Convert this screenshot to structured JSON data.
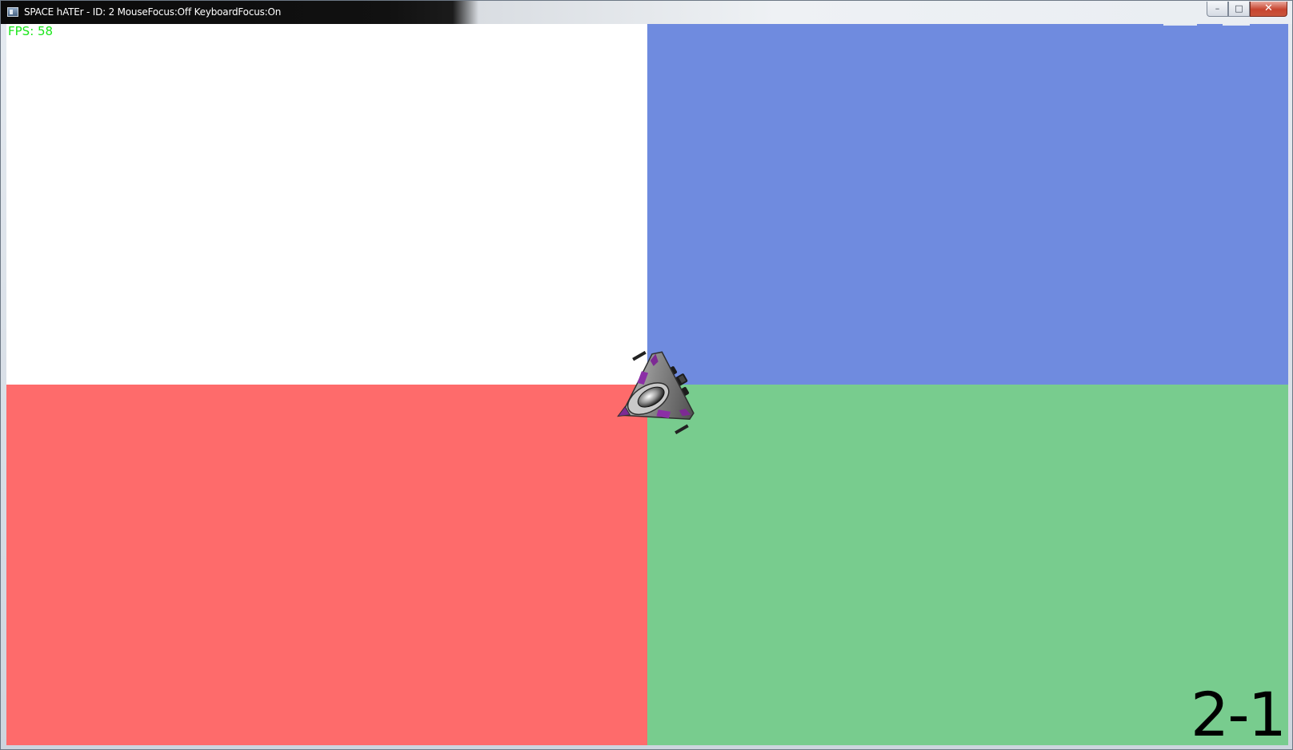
{
  "window": {
    "title": "SPACE hATEr - ID: 2 MouseFocus:Off KeyboardFocus:On",
    "controls": {
      "minimize": "–",
      "maximize": "□",
      "close": "✕"
    }
  },
  "hud": {
    "fps": "FPS: 58",
    "score": "2-1"
  },
  "colors": {
    "top_left": "#ffffff",
    "top_right": "#6f8bdf",
    "bottom_left": "#fe6b6b",
    "bottom_right": "#78cc8e",
    "fps_text": "#19e619"
  },
  "icons": {
    "app": "app-window-icon",
    "player": "spaceship-sprite"
  }
}
